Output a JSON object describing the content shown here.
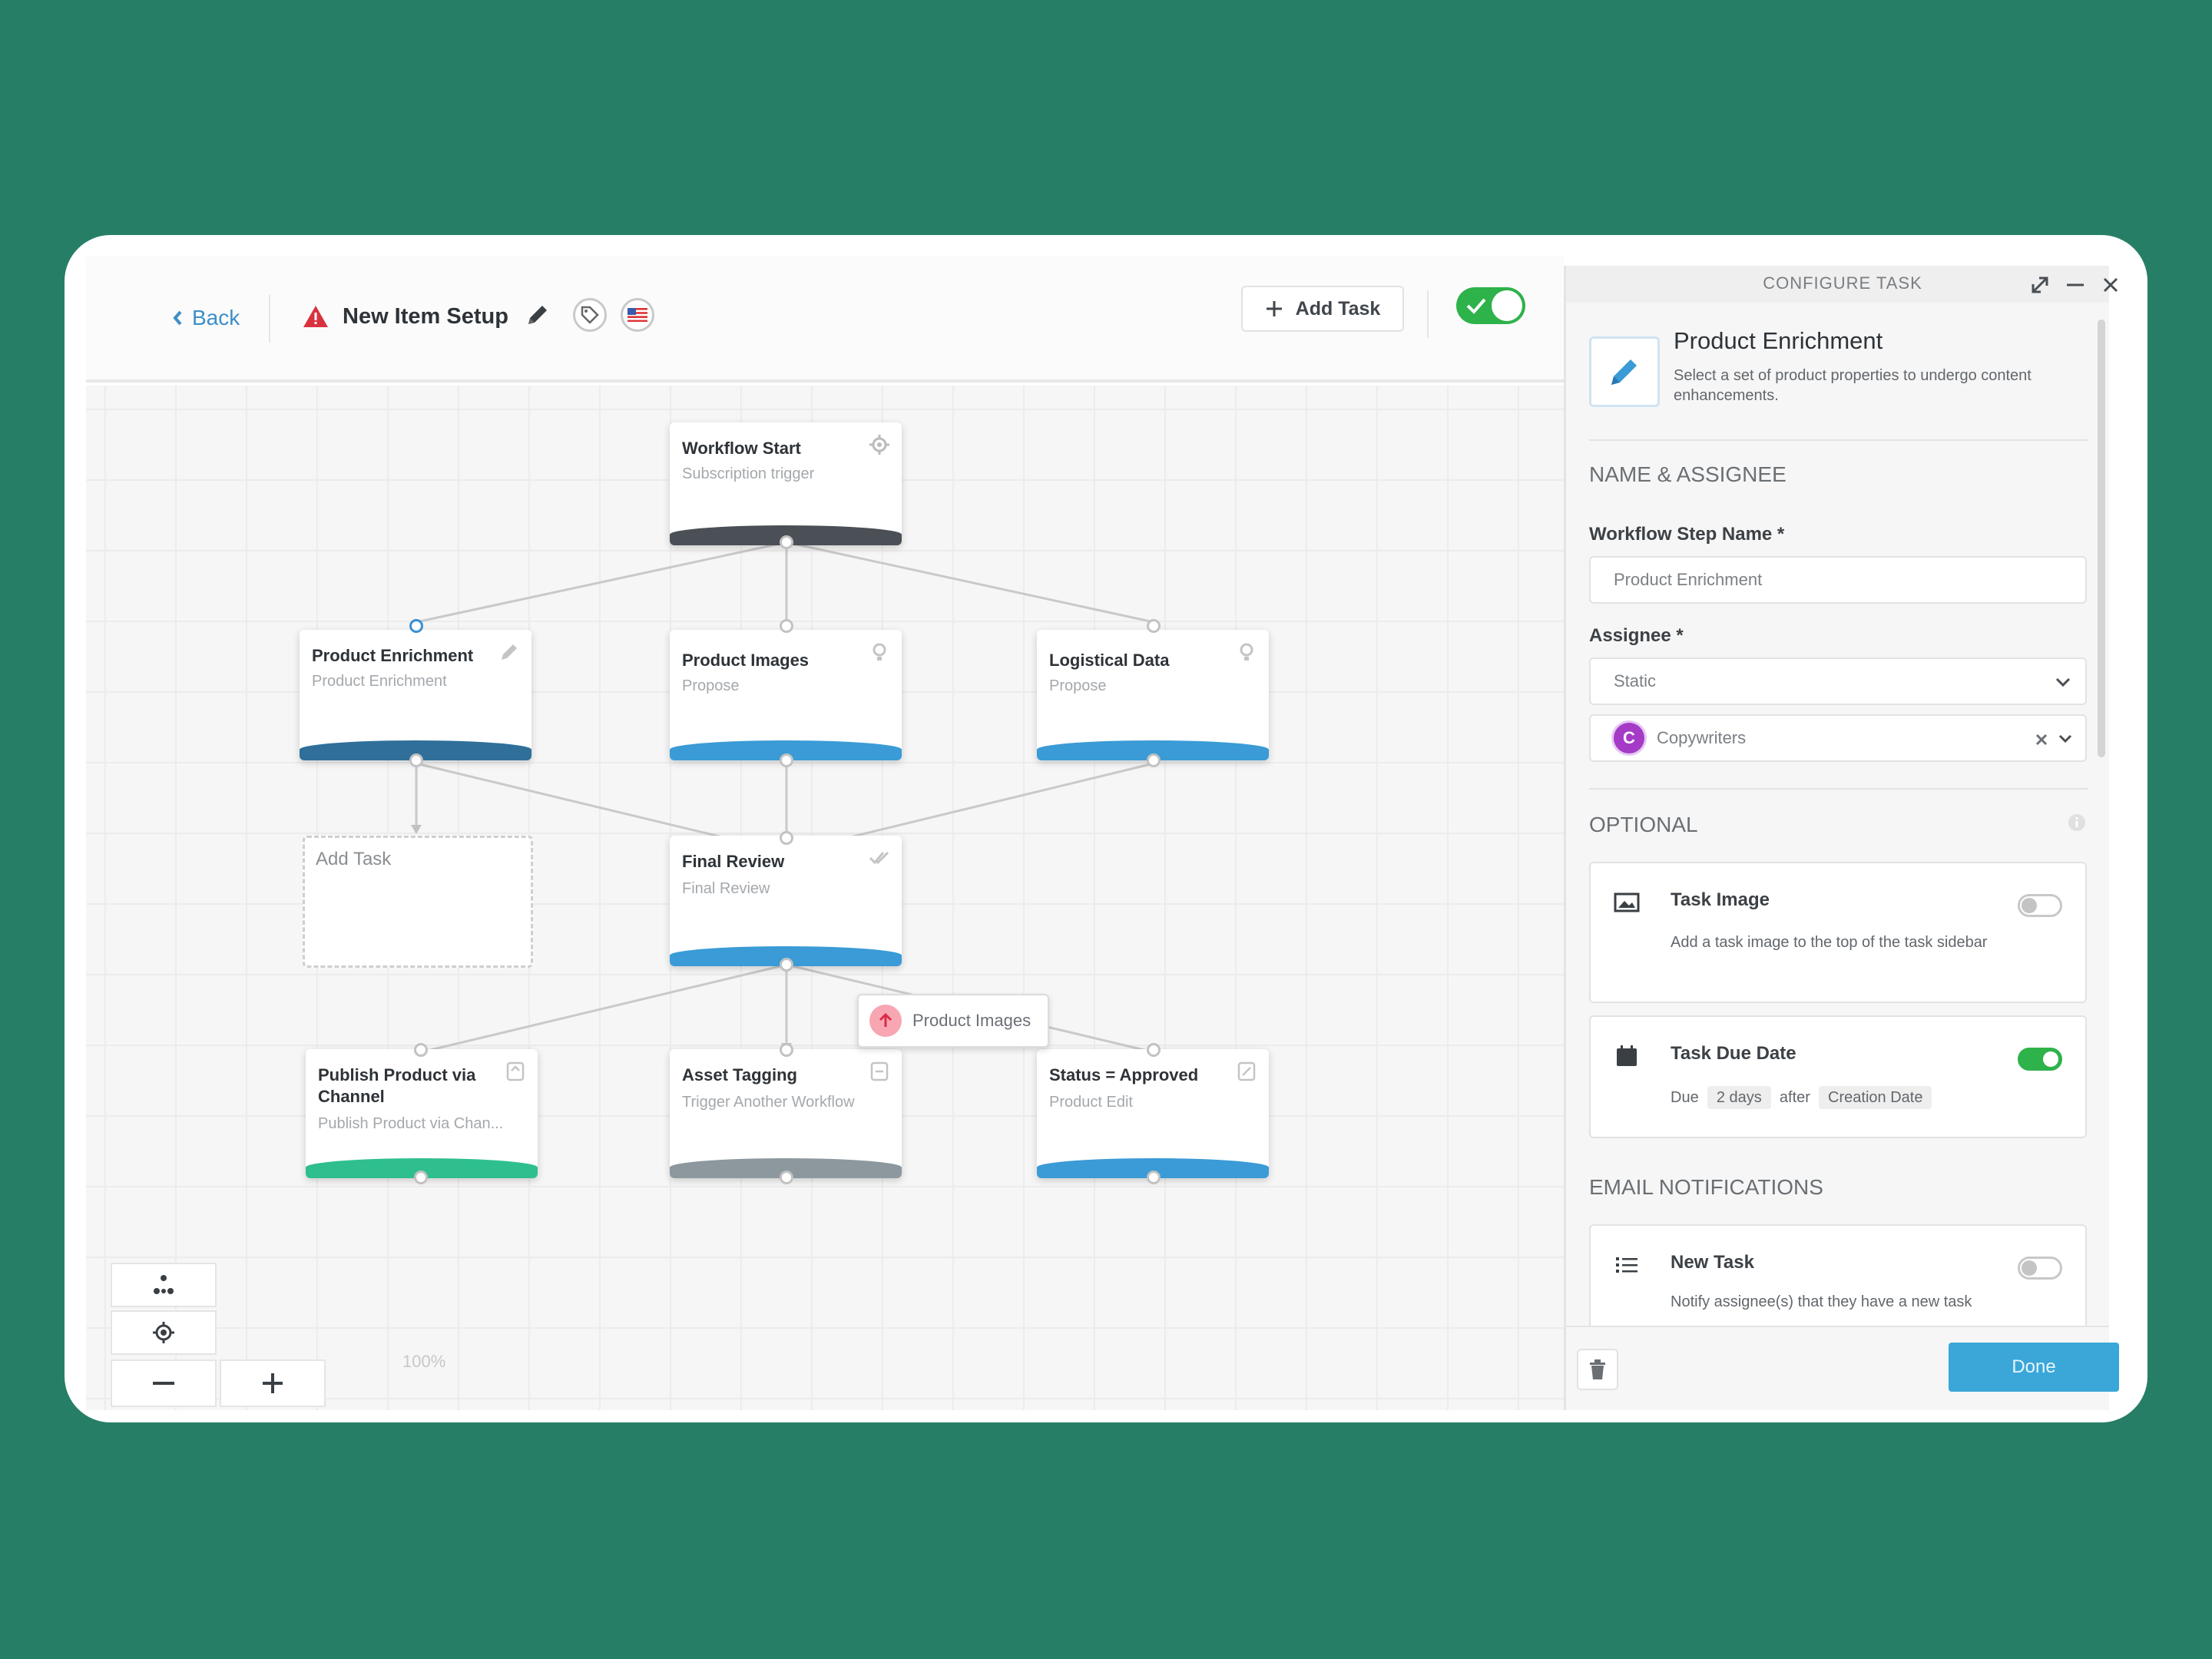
{
  "header": {
    "back_label": "Back",
    "workflow_title": "New Item Setup",
    "add_task_label": "Add Task",
    "active_toggle_on": true
  },
  "canvas": {
    "nodes": {
      "workflow_start": {
        "title": "Workflow Start",
        "subtitle": "Subscription trigger"
      },
      "product_enrichment": {
        "title": "Product Enrichment",
        "subtitle": "Product Enrichment"
      },
      "product_images": {
        "title": "Product Images",
        "subtitle": "Propose"
      },
      "logistical_data": {
        "title": "Logistical Data",
        "subtitle": "Propose"
      },
      "add_task": {
        "title": "Add Task"
      },
      "final_review": {
        "title": "Final Review",
        "subtitle": "Final Review"
      },
      "publish_product": {
        "title": "Publish Product via Channel",
        "subtitle": "Publish Product via Chan..."
      },
      "asset_tagging": {
        "title": "Asset Tagging",
        "subtitle": "Trigger Another Workflow"
      },
      "status_approved": {
        "title": "Status = Approved",
        "subtitle": "Product Edit"
      }
    },
    "tooltip_label": "Product Images",
    "zoom_level": "100%"
  },
  "panel": {
    "header_title": "CONFIGURE TASK",
    "task_title": "Product Enrichment",
    "task_description": "Select a set of product properties to undergo content enhancements.",
    "section_name_assignee": "NAME & ASSIGNEE",
    "step_name_label": "Workflow Step Name *",
    "step_name_value": "Product Enrichment",
    "assignee_label": "Assignee *",
    "assignee_type": "Static",
    "assignee_avatar": "C",
    "assignee_value": "Copywriters",
    "section_optional": "OPTIONAL",
    "task_image": {
      "title": "Task Image",
      "desc": "Add a task image to the top of the task sidebar",
      "enabled": false
    },
    "task_due_date": {
      "title": "Task Due Date",
      "due_label": "Due",
      "due_amount": "2 days",
      "after_label": "after",
      "after_value": "Creation Date",
      "enabled": true
    },
    "section_email": "EMAIL NOTIFICATIONS",
    "new_task": {
      "title": "New Task",
      "desc": "Notify assignee(s) that they have a new task",
      "enabled": false
    },
    "done_label": "Done"
  },
  "colors": {
    "background": "#267e66",
    "accent_blue": "#3aa7d8",
    "toggle_green": "#2eb24a",
    "bar_dark": "#4b5056",
    "bar_navy": "#2f6f9a",
    "bar_blue": "#3a9bd6",
    "bar_teal": "#2fbf8e",
    "bar_grey": "#8c989e"
  }
}
